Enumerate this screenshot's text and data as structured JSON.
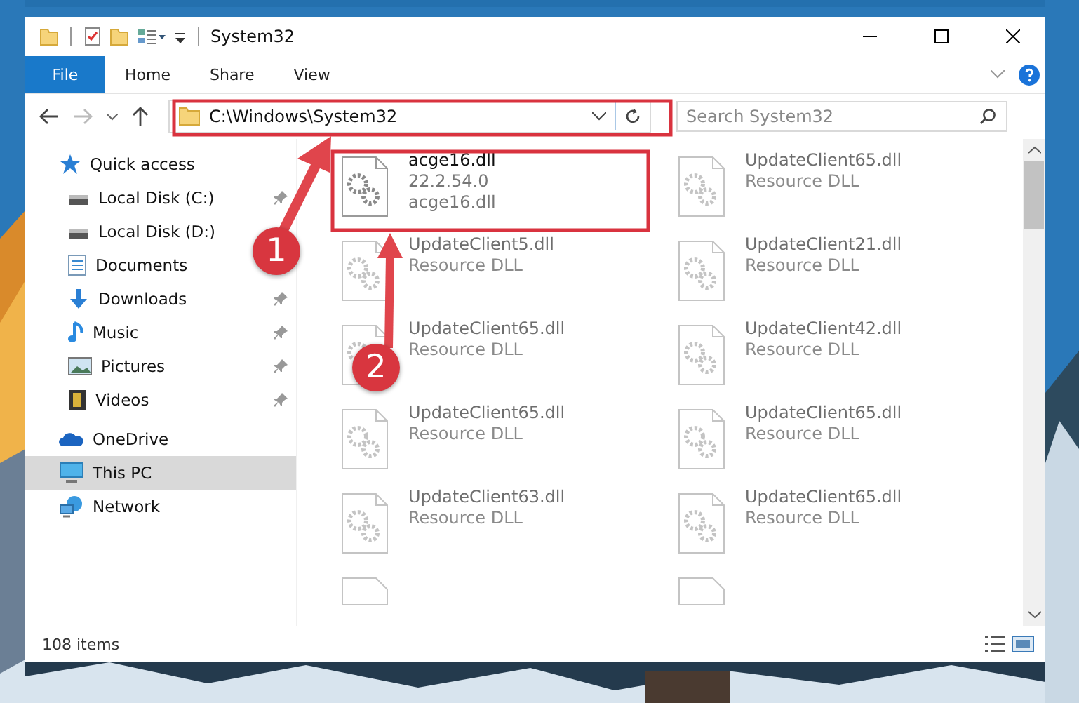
{
  "window": {
    "title": "System32"
  },
  "ribbon": {
    "tabs": [
      {
        "label": "File",
        "kind": "file"
      },
      {
        "label": "Home",
        "kind": "tab"
      },
      {
        "label": "Share",
        "kind": "tab"
      },
      {
        "label": "View",
        "kind": "tab"
      }
    ]
  },
  "address_bar": {
    "path": "C:\\Windows\\System32"
  },
  "search": {
    "placeholder": "Search System32"
  },
  "sidebar": {
    "items": [
      {
        "label": "Quick access",
        "selected": false,
        "children": [
          {
            "label": "Local Disk (C:)",
            "pinned": true,
            "selected": false
          },
          {
            "label": "Local Disk (D:)",
            "pinned": false,
            "selected": false
          },
          {
            "label": "Documents",
            "pinned": false,
            "selected": false
          },
          {
            "label": "Downloads",
            "pinned": true,
            "selected": false
          },
          {
            "label": "Music",
            "pinned": true,
            "selected": false
          },
          {
            "label": "Pictures",
            "pinned": true,
            "selected": false
          },
          {
            "label": "Videos",
            "pinned": true,
            "selected": false
          }
        ]
      },
      {
        "label": "OneDrive",
        "selected": false
      },
      {
        "label": "This PC",
        "selected": true
      },
      {
        "label": "Network",
        "selected": false
      }
    ]
  },
  "files": [
    {
      "name": "acge16.dll",
      "lines": [
        "22.2.54.0",
        "acge16.dll"
      ],
      "dimmed": false
    },
    {
      "name": "UpdateClient65.dll",
      "lines": [
        "Resource DLL"
      ],
      "dimmed": true
    },
    {
      "name": "UpdateClient5.dll",
      "lines": [
        "Resource DLL"
      ],
      "dimmed": true
    },
    {
      "name": "UpdateClient21.dll",
      "lines": [
        "Resource DLL"
      ],
      "dimmed": true
    },
    {
      "name": "UpdateClient65.dll",
      "lines": [
        "Resource DLL"
      ],
      "dimmed": true
    },
    {
      "name": "UpdateClient42.dll",
      "lines": [
        "Resource DLL"
      ],
      "dimmed": true
    },
    {
      "name": "UpdateClient65.dll",
      "lines": [
        "Resource DLL"
      ],
      "dimmed": true
    },
    {
      "name": "UpdateClient65.dll",
      "lines": [
        "Resource DLL"
      ],
      "dimmed": true
    },
    {
      "name": "UpdateClient63.dll",
      "lines": [
        "Resource DLL"
      ],
      "dimmed": true
    },
    {
      "name": "UpdateClient65.dll",
      "lines": [
        "Resource DLL"
      ],
      "dimmed": true
    }
  ],
  "status_bar": {
    "text": "108 items"
  },
  "annotations": [
    {
      "label": "1"
    },
    {
      "label": "2"
    }
  ]
}
